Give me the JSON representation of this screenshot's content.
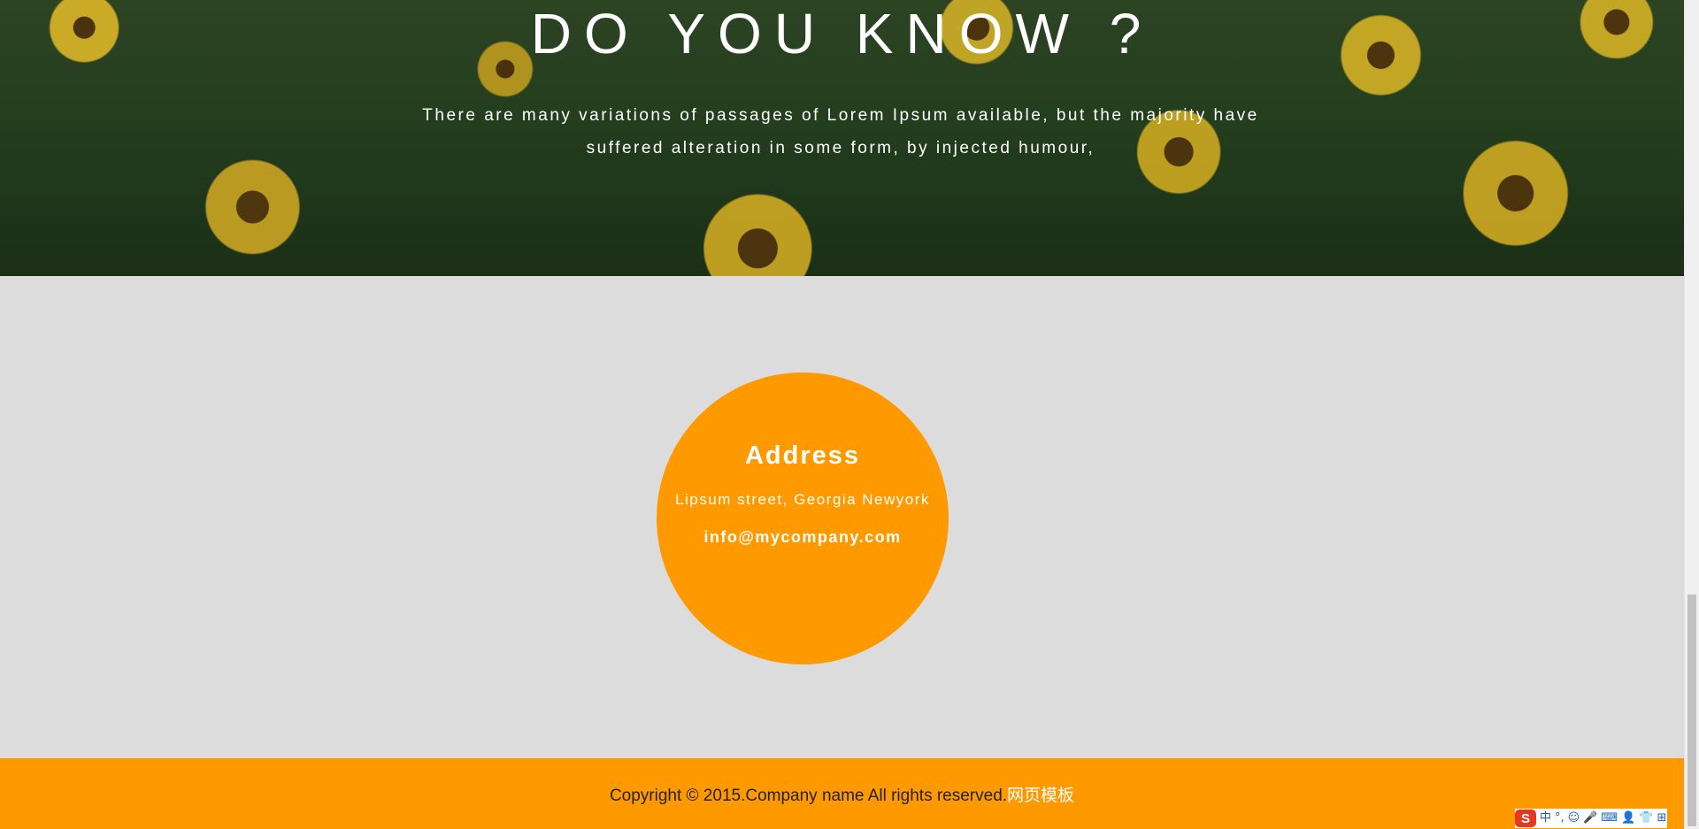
{
  "hero": {
    "title": "DO YOU KNOW ?",
    "text": "There are many variations of passages of Lorem Ipsum available, but the majority have suffered alteration in some form, by injected humour,"
  },
  "address": {
    "title": "Address",
    "line": "Lipsum street, Georgia Newyork",
    "email": "info@mycompany.com"
  },
  "footer": {
    "copyright": "Copyright © 2015.Company name All rights reserved.",
    "link": "网页模板"
  },
  "ime": {
    "logo": "S",
    "items": [
      "中",
      "°,",
      "☺",
      "🎤",
      "⌨",
      "👤",
      "👕",
      "⊞"
    ]
  },
  "colors": {
    "accent": "#ff9900",
    "background": "#dcdcdc",
    "footer_text": "#222222",
    "white": "#ffffff"
  }
}
